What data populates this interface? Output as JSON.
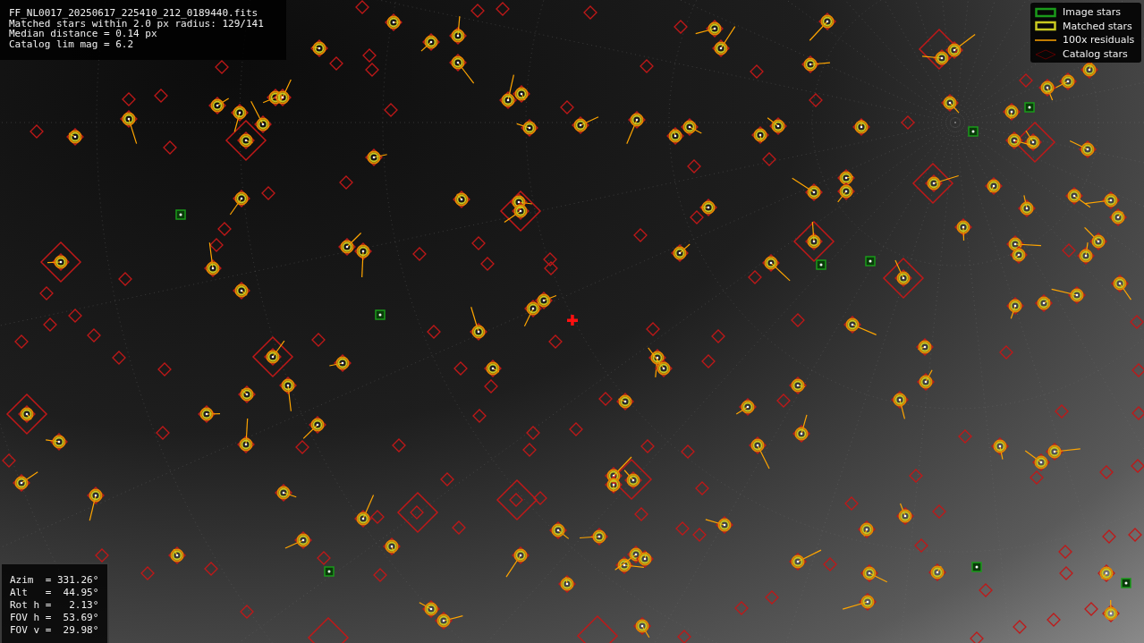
{
  "image_info": {
    "lines": [
      "FF_NL0017_20250617_225410_212_0189440.fits",
      "Matched stars within 2.0 px radius: 129/141",
      "Median distance = 0.14 px",
      "Catalog lim mag = 6.2"
    ]
  },
  "legend": [
    {
      "kind": "image",
      "label": "Image stars"
    },
    {
      "kind": "matched",
      "label": "Matched stars"
    },
    {
      "kind": "residual",
      "label": "100x residuals"
    },
    {
      "kind": "catalog",
      "label": "Catalog stars"
    }
  ],
  "pointing": {
    "lines": [
      "Azim  = 331.26°",
      "Alt   =  44.95°",
      "Rot h =   2.13°",
      "FOV h =  53.69°",
      "FOV v =  29.98°"
    ]
  }
}
